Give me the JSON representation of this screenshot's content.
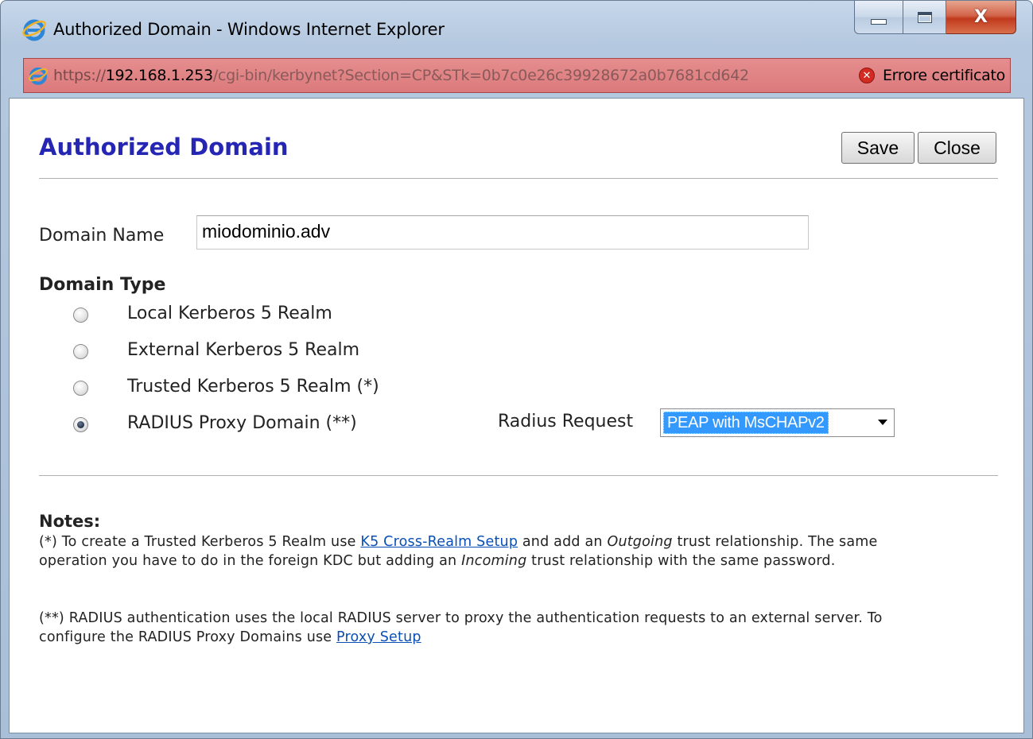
{
  "window": {
    "title": "Authorized Domain - Windows Internet Explorer",
    "minimize_icon": "minimize-icon",
    "maximize_icon": "maximize-icon",
    "close_icon": "close-icon",
    "close_glyph": "X"
  },
  "addressbar": {
    "url_protocol": "https://",
    "url_host": "192.168.1.253",
    "url_path": "/cgi-bin/kerbynet?Section=CP&STk=0b7c0e26c39928672a0b7681cd642",
    "cert_icon": "error-icon",
    "cert_glyph": "✕",
    "cert_text": "Errore certificato",
    "bg_color": "#e0878a"
  },
  "page": {
    "title": "Authorized Domain",
    "title_color": "#2626b5",
    "save_label": "Save",
    "close_label": "Close"
  },
  "form": {
    "domain_name_label": "Domain Name",
    "domain_name_value": "miodominio.adv",
    "domain_type_label": "Domain Type",
    "domain_types": [
      {
        "label": "Local Kerberos 5 Realm",
        "checked": false
      },
      {
        "label": "External Kerberos 5 Realm",
        "checked": false
      },
      {
        "label": "Trusted Kerberos 5 Realm (*)",
        "checked": false
      },
      {
        "label": "RADIUS Proxy Domain (**)",
        "checked": true
      }
    ],
    "radius_request_label": "Radius Request",
    "radius_request_value": "PEAP with MsCHAPv2"
  },
  "notes": {
    "title": "Notes:",
    "p1_a": "(*) To create a Trusted Kerberos 5 Realm use ",
    "p1_link": "K5 Cross-Realm Setup",
    "p1_b": " and add an ",
    "p1_em1": "Outgoing",
    "p1_c": " trust relationship. The same operation you have to do in the foreign KDC but adding an ",
    "p1_em2": "Incoming",
    "p1_d": " trust relationship with the same password.",
    "p2_a": "(**) RADIUS authentication uses the local RADIUS server to proxy the authentication requests to an external server. To configure the RADIUS Proxy Domains use ",
    "p2_link": "Proxy Setup"
  }
}
